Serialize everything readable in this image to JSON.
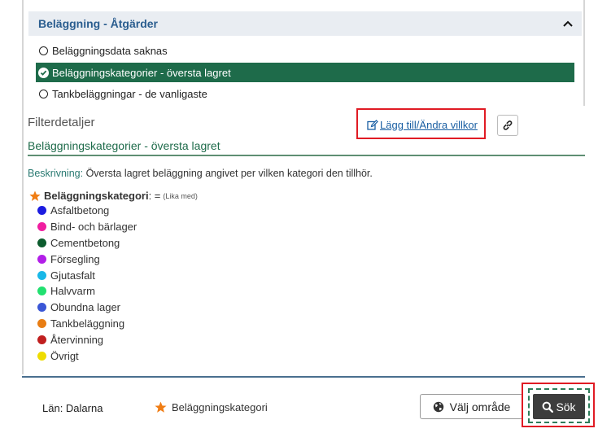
{
  "accordion": {
    "title": "Beläggning - Åtgärder",
    "options": [
      {
        "label": "Beläggningsdata saknas",
        "selected": false
      },
      {
        "label": "Beläggningskategorier - översta lagret",
        "selected": true
      },
      {
        "label": "Tankbeläggningar - de vanligaste",
        "selected": false
      }
    ]
  },
  "filter": {
    "heading": "Filterdetaljer",
    "edit_link": "Lägg till/Ändra villkor",
    "selected_name": "Beläggningskategorier - översta lagret",
    "description_label": "Beskrivning:",
    "description_text": "Översta lagret beläggning angivet per vilken kategori den tillhör.",
    "criterion_label": "Beläggningskategori",
    "criterion_op": ": = ",
    "criterion_op_text": "(Lika med)",
    "categories": [
      {
        "label": "Asfaltbetong",
        "color": "#1c1ce0"
      },
      {
        "label": "Bind- och bärlager",
        "color": "#f01ea0"
      },
      {
        "label": "Cementbetong",
        "color": "#0d5c2e"
      },
      {
        "label": "Försegling",
        "color": "#b21ee8"
      },
      {
        "label": "Gjutasfalt",
        "color": "#19b8e8"
      },
      {
        "label": "Halvvarm",
        "color": "#22e070"
      },
      {
        "label": "Obundna lager",
        "color": "#3a56d6"
      },
      {
        "label": "Tankbeläggning",
        "color": "#e87d14"
      },
      {
        "label": "Återvinning",
        "color": "#c01f1f"
      },
      {
        "label": "Övrigt",
        "color": "#eedc00"
      }
    ]
  },
  "footer": {
    "lan": "Län: Dalarna",
    "criterion": "Beläggningskategori",
    "valj_button": "Välj område",
    "sok_button": "Sök"
  },
  "colors": {
    "accent_green": "#1e6b4a",
    "star_orange": "#f07d14",
    "link_blue": "#1a5fa3",
    "highlight_red": "#e01b24"
  }
}
